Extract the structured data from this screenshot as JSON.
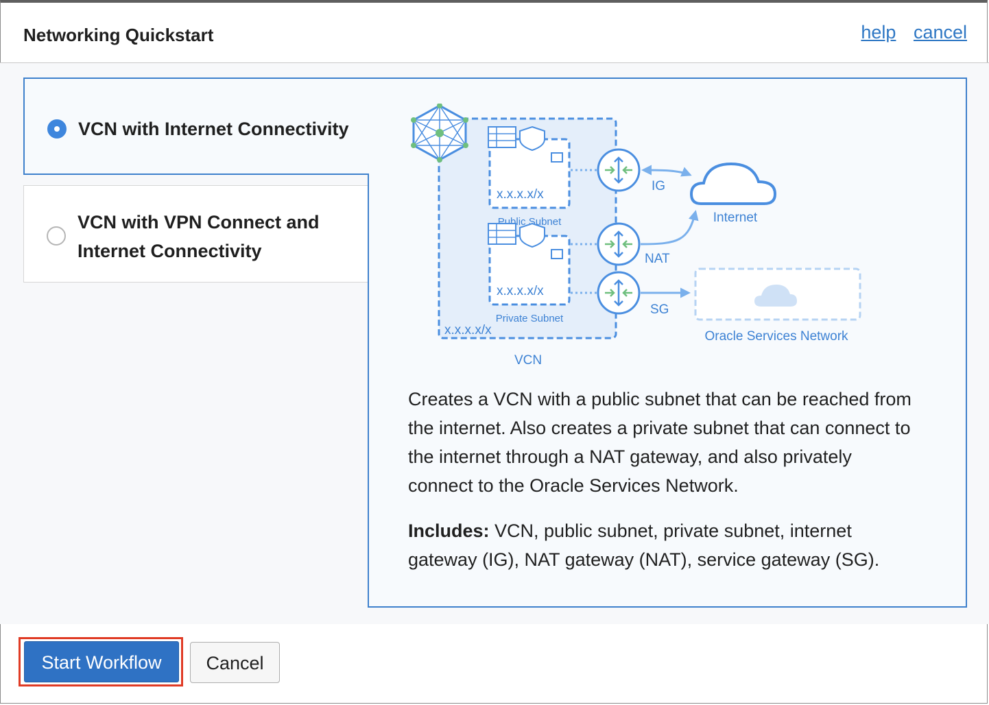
{
  "dialog": {
    "title": "Networking Quickstart",
    "help_link": "help",
    "cancel_link": "cancel"
  },
  "options": [
    {
      "label": "VCN with Internet Connectivity",
      "selected": true
    },
    {
      "label": "VCN with VPN Connect and Internet Connectivity",
      "selected": false
    }
  ],
  "diagram": {
    "public_subnet_cidr": "x.x.x.x/x",
    "public_subnet_label": "Public Subnet",
    "private_subnet_cidr": "x.x.x.x/x",
    "private_subnet_label": "Private Subnet",
    "vcn_cidr": "x.x.x.x/x",
    "vcn_label": "VCN",
    "ig_label": "IG",
    "nat_label": "NAT",
    "sg_label": "SG",
    "internet_label": "Internet",
    "osn_label": "Oracle Services Network"
  },
  "description": "Creates a VCN with a public subnet that can be reached from the internet. Also creates a private subnet that can connect to the internet through a NAT gateway, and also privately connect to the Oracle Services Network.",
  "includes": {
    "label": "Includes:",
    "text": " VCN, public subnet, private subnet, internet gateway (IG), NAT gateway (NAT), service gateway (SG)."
  },
  "footer": {
    "start_label": "Start Workflow",
    "cancel_label": "Cancel"
  },
  "colors": {
    "accent": "#3e80cc",
    "primary_button": "#2f72c4",
    "highlight_border": "#e03b25"
  }
}
